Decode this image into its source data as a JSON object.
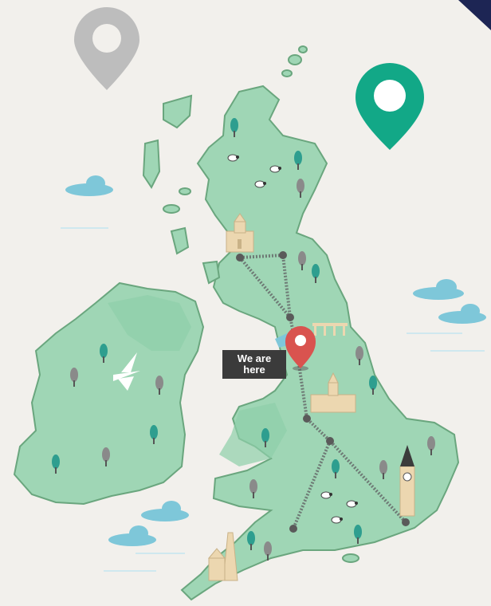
{
  "location_label": {
    "line1": "We are",
    "line2": "here"
  },
  "colors": {
    "background": "#f2f0ec",
    "land": "#9fd6b5",
    "land_dark": "#7fc49c",
    "coast": "#6aa67e",
    "route": "#6e7a75",
    "node": "#5a5a5a",
    "marker_red": "#d9534f",
    "marker_green": "#12a887",
    "marker_gray": "#bdbdbd",
    "cloud": "#7ec7d9",
    "tree": "#2e9e8f",
    "tree_gray": "#8a8a8a",
    "landmark": "#ecd7b0",
    "corner_flag": "#1d2554"
  },
  "icons": [
    "map-pin-icon",
    "tree-icon",
    "sheep-icon",
    "cloud-icon",
    "cathedral-icon",
    "clock-tower-icon",
    "lighthouse-icon",
    "bird-icon",
    "bridge-icon"
  ]
}
